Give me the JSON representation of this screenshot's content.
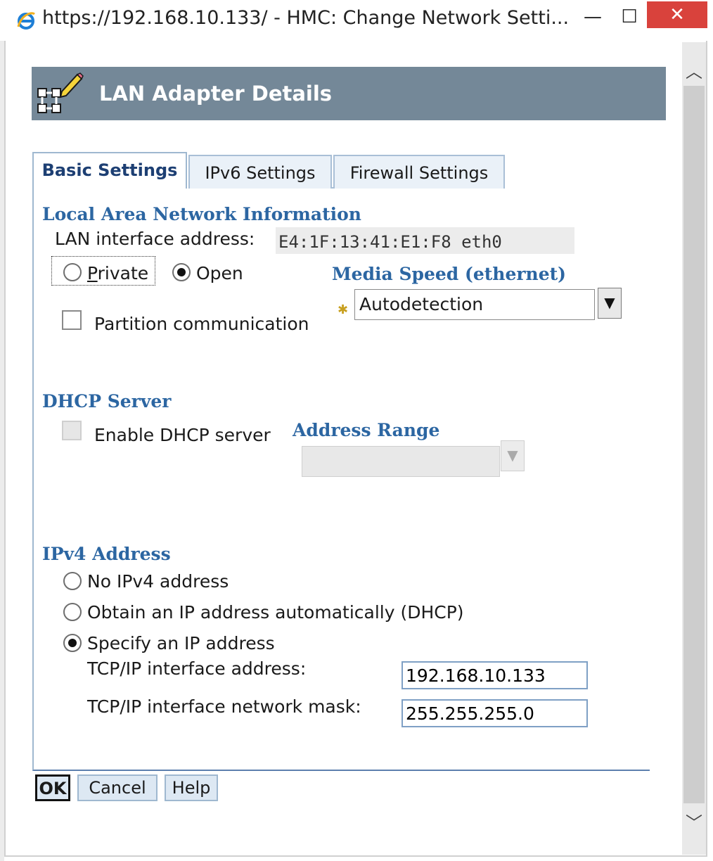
{
  "window": {
    "title": "https://192.168.10.133/ - HMC: Change Network Setti...",
    "minimize_glyph": "—",
    "maximize_glyph": "☐",
    "close_glyph": "✕",
    "ie_icon": "internet-explorer-icon"
  },
  "header": {
    "title": "LAN Adapter Details",
    "icon": "network-edit-icon"
  },
  "tabs": [
    {
      "label": "Basic Settings",
      "selected": true
    },
    {
      "label": "IPv6 Settings",
      "selected": false
    },
    {
      "label": "Firewall Settings",
      "selected": false
    }
  ],
  "lan": {
    "section_title": "Local Area Network Information",
    "interface_label": "LAN interface address:",
    "interface_value": "E4:1F:13:41:E1:F8 eth0",
    "private_label": "Private",
    "open_label": "Open",
    "selected": "open",
    "partition_label": "Partition communication",
    "partition_checked": false
  },
  "media": {
    "section_title": "Media Speed (ethernet)",
    "required_marker": "✱",
    "value": "Autodetection"
  },
  "dhcp": {
    "section_title": "DHCP Server",
    "enable_label": "Enable DHCP server",
    "enable_checked": false,
    "range_title": "Address Range",
    "range_value": ""
  },
  "ipv4": {
    "section_title": "IPv4 Address",
    "options": [
      {
        "label": "No IPv4 address",
        "selected": false
      },
      {
        "label": "Obtain an IP address automatically (DHCP)",
        "selected": false
      },
      {
        "label": "Specify an IP address",
        "selected": true
      }
    ],
    "address_label": "TCP/IP interface address:",
    "address_value": "192.168.10.133",
    "mask_label": "TCP/IP interface network mask:",
    "mask_value": "255.255.255.0"
  },
  "buttons": {
    "ok": "OK",
    "cancel": "Cancel",
    "help": "Help"
  },
  "colors": {
    "banner": "#748898",
    "section_title": "#2c66a2",
    "close_button": "#d9423c"
  }
}
